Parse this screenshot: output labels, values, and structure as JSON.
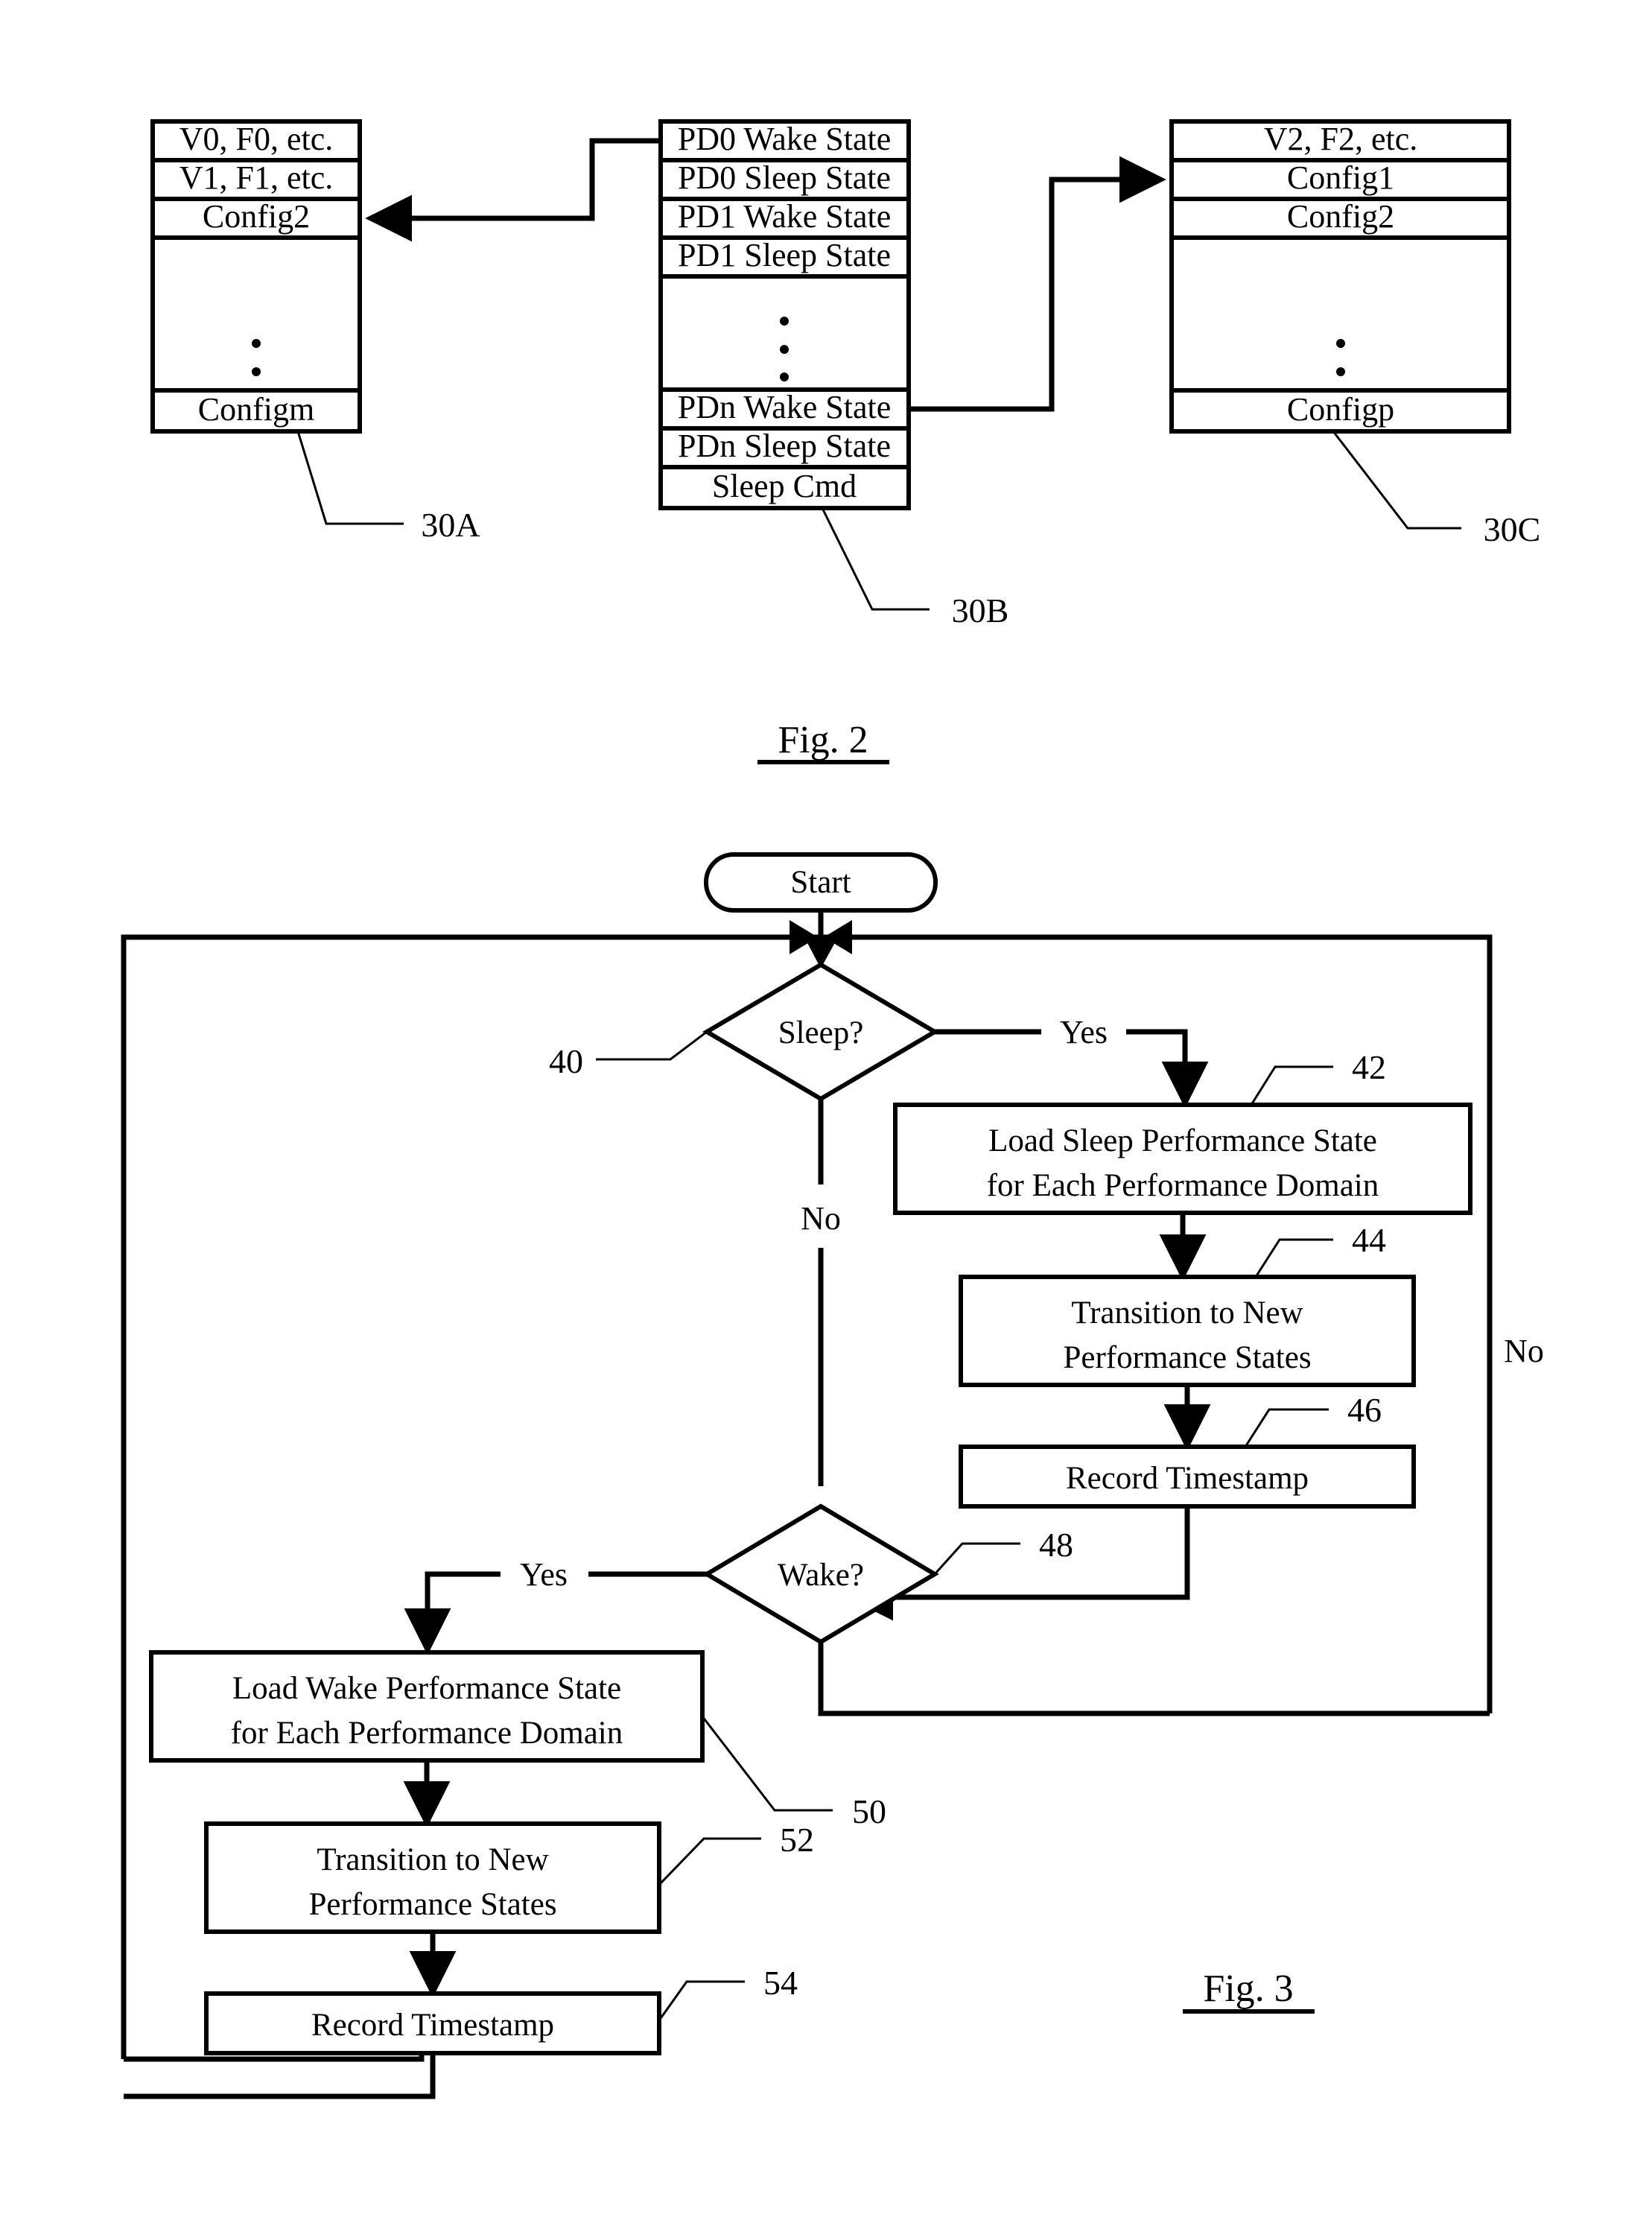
{
  "figure2": {
    "caption": "Fig. 2",
    "tables": [
      {
        "ref": "30A",
        "name": "performance-state-table-left",
        "rows": [
          "V0, F0, etc.",
          "V1, F1, etc.",
          "Config2",
          "⋮",
          "Configm"
        ]
      },
      {
        "ref": "30B",
        "name": "sleep-wake-state-table-middle",
        "rows": [
          "PD0 Wake State",
          "PD0 Sleep State",
          "PD1 Wake State",
          "PD1 Sleep State",
          "⋮",
          "PDn Wake State",
          "PDn Sleep State",
          "Sleep Cmd"
        ]
      },
      {
        "ref": "30C",
        "name": "performance-state-table-right",
        "rows": [
          "V2, F2, etc.",
          "Config1",
          "Config2",
          "⋮",
          "Configp"
        ]
      }
    ]
  },
  "figure3": {
    "caption": "Fig. 3",
    "start_label": "Start",
    "nodes": [
      {
        "id": "40",
        "name": "sleep-decision",
        "type": "decision",
        "label": "Sleep?"
      },
      {
        "id": "42",
        "name": "load-sleep-performance-state-box",
        "type": "process",
        "label": "Load Sleep Performance State\nfor Each Performance Domain",
        "line1": "Load Sleep Performance State",
        "line2": "for Each Performance Domain"
      },
      {
        "id": "44",
        "name": "transition-new-performance-states-sleep-box",
        "type": "process",
        "label": "Transition to New\nPerformance States",
        "line1": "Transition to New",
        "line2": "Performance States"
      },
      {
        "id": "46",
        "name": "record-timestamp-sleep-box",
        "type": "process",
        "label": "Record Timestamp",
        "line1": "Record Timestamp",
        "line2": ""
      },
      {
        "id": "48",
        "name": "wake-decision",
        "type": "decision",
        "label": "Wake?"
      },
      {
        "id": "50",
        "name": "load-wake-performance-state-box",
        "type": "process",
        "label": "Load Wake Performance State\nfor Each Performance Domain",
        "line1": "Load Wake Performance State",
        "line2": "for Each Performance Domain"
      },
      {
        "id": "52",
        "name": "transition-new-performance-states-wake-box",
        "type": "process",
        "label": "Transition to New\nPerformance States",
        "line1": "Transition to New",
        "line2": "Performance States"
      },
      {
        "id": "54",
        "name": "record-timestamp-wake-box",
        "type": "process",
        "label": "Record Timestamp",
        "line1": "Record Timestamp",
        "line2": ""
      }
    ],
    "edge_labels": {
      "sleep_yes": "Yes",
      "sleep_no": "No",
      "wake_yes": "Yes",
      "wake_no": "No"
    }
  },
  "colors": {
    "ink": "#000000",
    "paper": "#ffffff"
  }
}
